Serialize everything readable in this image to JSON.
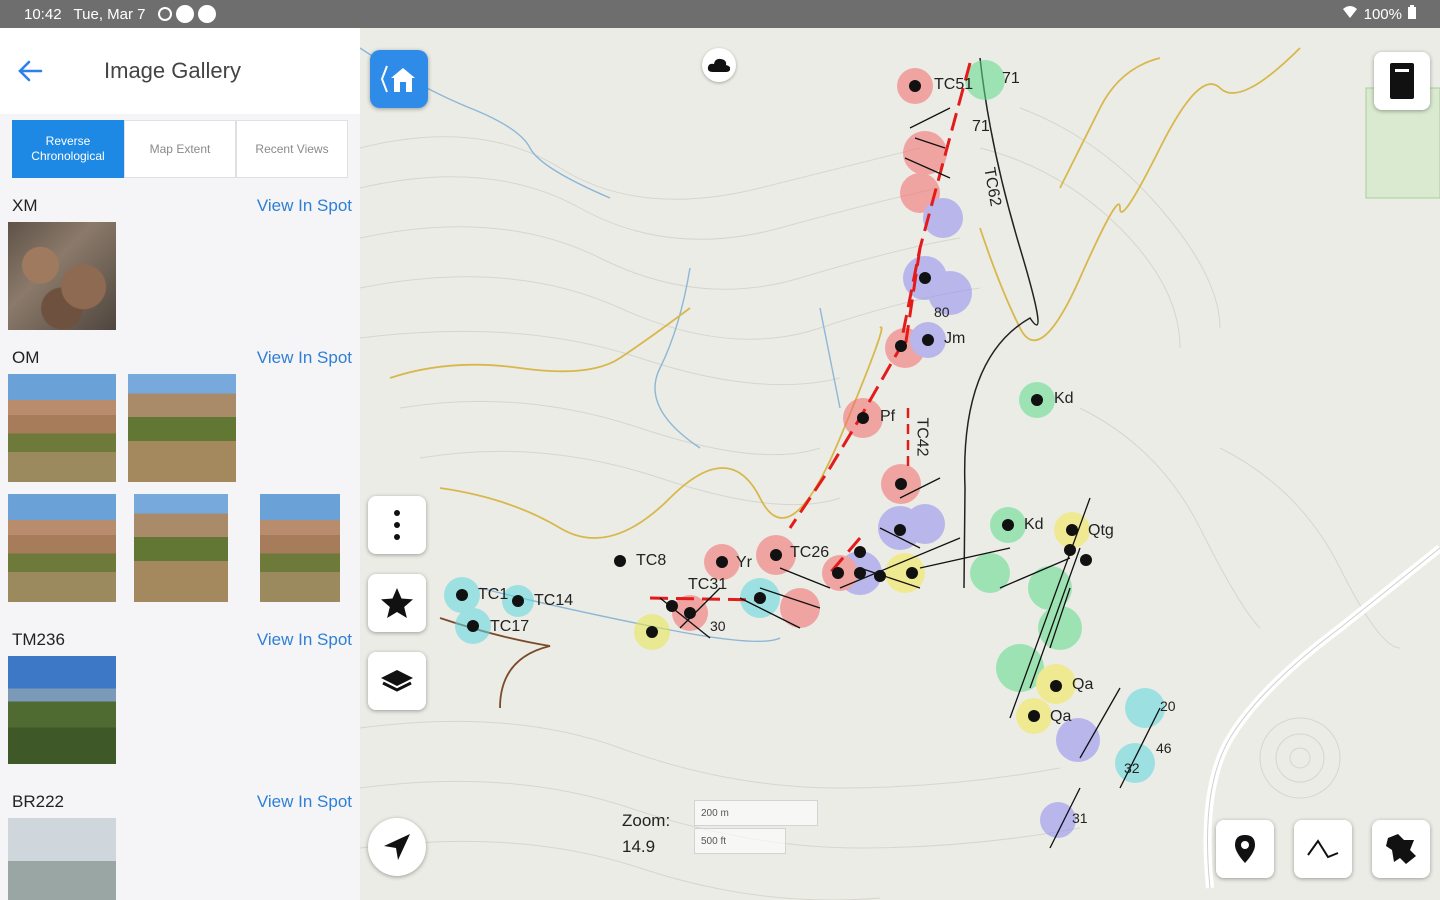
{
  "status_bar": {
    "time": "10:42",
    "date": "Tue, Mar 7",
    "battery": "100%"
  },
  "sidebar": {
    "title": "Image Gallery",
    "sort_tabs": [
      {
        "label": "Reverse Chronological",
        "active": true
      },
      {
        "label": "Map Extent",
        "active": false
      },
      {
        "label": "Recent Views",
        "active": false
      }
    ],
    "groups": [
      {
        "name": "XM",
        "link": "View In Spot",
        "thumbs": [
          "rock"
        ]
      },
      {
        "name": "OM",
        "link": "View In Spot",
        "thumbs": [
          "hill",
          "hill2",
          "hill",
          "hill2",
          "hill"
        ]
      },
      {
        "name": "TM236",
        "link": "View In Spot",
        "thumbs": [
          "valley"
        ]
      },
      {
        "name": "BR222",
        "link": "View In Spot",
        "thumbs": [
          "sky"
        ]
      }
    ]
  },
  "map": {
    "zoom_label": "Zoom:",
    "zoom_value": "14.9",
    "scale_metric": "200 m",
    "scale_imperial": "500 ft",
    "accent_color": "#2e8ce8",
    "spot_labels": [
      "TC51",
      "71",
      "71",
      "TC62",
      "TC42",
      "Pf",
      "Kd",
      "TC8",
      "TC26",
      "TC31",
      "TC14",
      "TC1",
      "TC17",
      "Kd",
      "Qtg",
      "Qa",
      "Qa",
      "20",
      "46",
      "32",
      "31",
      "Yr",
      "Jm",
      "80",
      "30"
    ],
    "tools": [
      "home-icon",
      "notebook-icon",
      "more-vertical-icon",
      "star-icon",
      "layers-icon",
      "navigation-icon",
      "map-pin-icon",
      "line-tool-icon",
      "polygon-tool-icon",
      "cloud-icon"
    ]
  }
}
